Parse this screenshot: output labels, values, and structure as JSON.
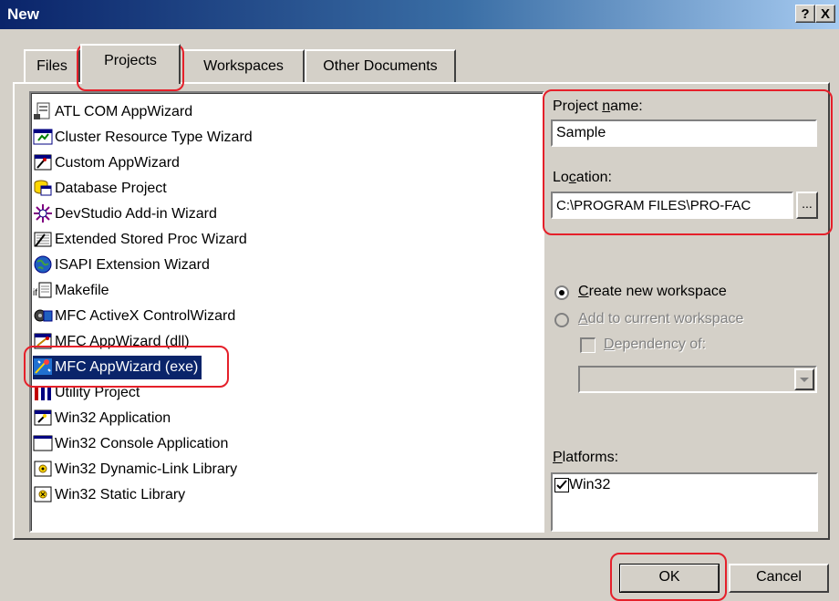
{
  "window": {
    "title": "New",
    "help_label": "?",
    "close_label": "X"
  },
  "tabs": [
    {
      "label": "Files",
      "active": false
    },
    {
      "label": "Projects",
      "active": true
    },
    {
      "label": "Workspaces",
      "active": false
    },
    {
      "label": "Other Documents",
      "active": false
    }
  ],
  "project_types": [
    {
      "label": "ATL COM AppWizard",
      "icon": "atl-com-icon"
    },
    {
      "label": "Cluster Resource Type Wizard",
      "icon": "cluster-wizard-icon"
    },
    {
      "label": "Custom AppWizard",
      "icon": "custom-appwizard-icon"
    },
    {
      "label": "Database Project",
      "icon": "database-icon"
    },
    {
      "label": "DevStudio Add-in Wizard",
      "icon": "addin-wizard-icon"
    },
    {
      "label": "Extended Stored Proc Wizard",
      "icon": "stored-proc-icon"
    },
    {
      "label": "ISAPI Extension Wizard",
      "icon": "globe-icon"
    },
    {
      "label": "Makefile",
      "icon": "makefile-icon"
    },
    {
      "label": "MFC ActiveX ControlWizard",
      "icon": "activex-icon"
    },
    {
      "label": "MFC AppWizard (dll)",
      "icon": "mfc-dll-icon"
    },
    {
      "label": "MFC AppWizard (exe)",
      "icon": "mfc-exe-icon",
      "selected": true
    },
    {
      "label": "Utility Project",
      "icon": "utility-icon"
    },
    {
      "label": "Win32 Application",
      "icon": "win32-app-icon"
    },
    {
      "label": "Win32 Console Application",
      "icon": "console-icon"
    },
    {
      "label": "Win32 Dynamic-Link Library",
      "icon": "dll-icon"
    },
    {
      "label": "Win32 Static Library",
      "icon": "static-lib-icon"
    }
  ],
  "project_name": {
    "label_pre": "Project ",
    "label_u": "n",
    "label_post": "ame:",
    "value": "Sample"
  },
  "location": {
    "label_pre": "Lo",
    "label_u": "c",
    "label_post": "ation:",
    "value": "C:\\PROGRAM FILES\\PRO-FAC",
    "browse_label": "..."
  },
  "workspace": {
    "create_u": "C",
    "create_rest": "reate new workspace",
    "add_u": "A",
    "add_rest": "dd to current workspace",
    "dependency_u": "D",
    "dependency_rest": "ependency of:",
    "selected": "create"
  },
  "platforms": {
    "label_pre": "",
    "label_u": "P",
    "label_post": "latforms:",
    "items": [
      {
        "label": "Win32",
        "checked": true
      }
    ]
  },
  "buttons": {
    "ok": "OK",
    "cancel": "Cancel"
  },
  "highlight_color": "#e5202a"
}
